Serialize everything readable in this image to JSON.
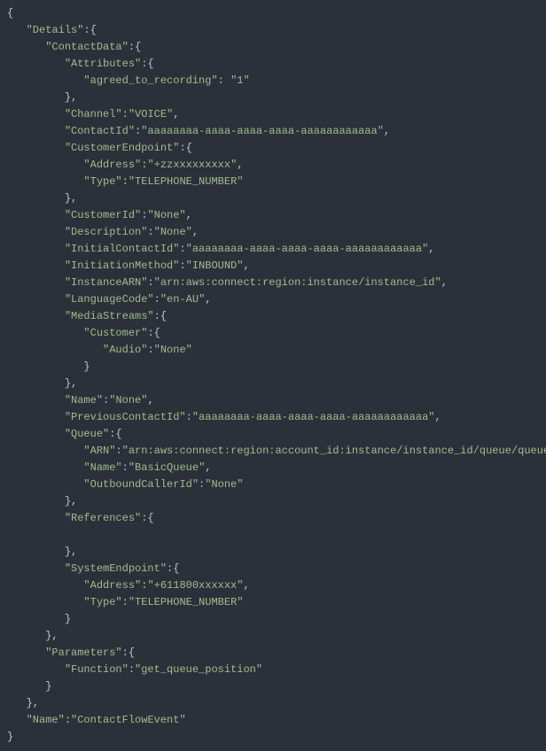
{
  "json_obj": {
    "Details": {
      "ContactData": {
        "Attributes": {
          "agreed_to_recording": "1"
        },
        "Channel": "VOICE",
        "ContactId": "aaaaaaaa-aaaa-aaaa-aaaa-aaaaaaaaaaaa",
        "CustomerEndpoint": {
          "Address": "+zzxxxxxxxxx",
          "Type": "TELEPHONE_NUMBER"
        },
        "CustomerId": "None",
        "Description": "None",
        "InitialContactId": "aaaaaaaa-aaaa-aaaa-aaaa-aaaaaaaaaaaa",
        "InitiationMethod": "INBOUND",
        "InstanceARN": "arn:aws:connect:region:instance/instance_id",
        "LanguageCode": "en-AU",
        "MediaStreams": {
          "Customer": {
            "Audio": "None"
          }
        },
        "Name": "None",
        "PreviousContactId": "aaaaaaaa-aaaa-aaaa-aaaa-aaaaaaaaaaaa",
        "Queue": {
          "ARN": "arn:aws:connect:region:account_id:instance/instance_id/queue/queue_id",
          "Name": "BasicQueue",
          "OutboundCallerId": "None"
        },
        "References": {},
        "SystemEndpoint": {
          "Address": "+611800xxxxxx",
          "Type": "TELEPHONE_NUMBER"
        }
      },
      "Parameters": {
        "Function": "get_queue_position"
      }
    },
    "Name": "ContactFlowEvent"
  }
}
